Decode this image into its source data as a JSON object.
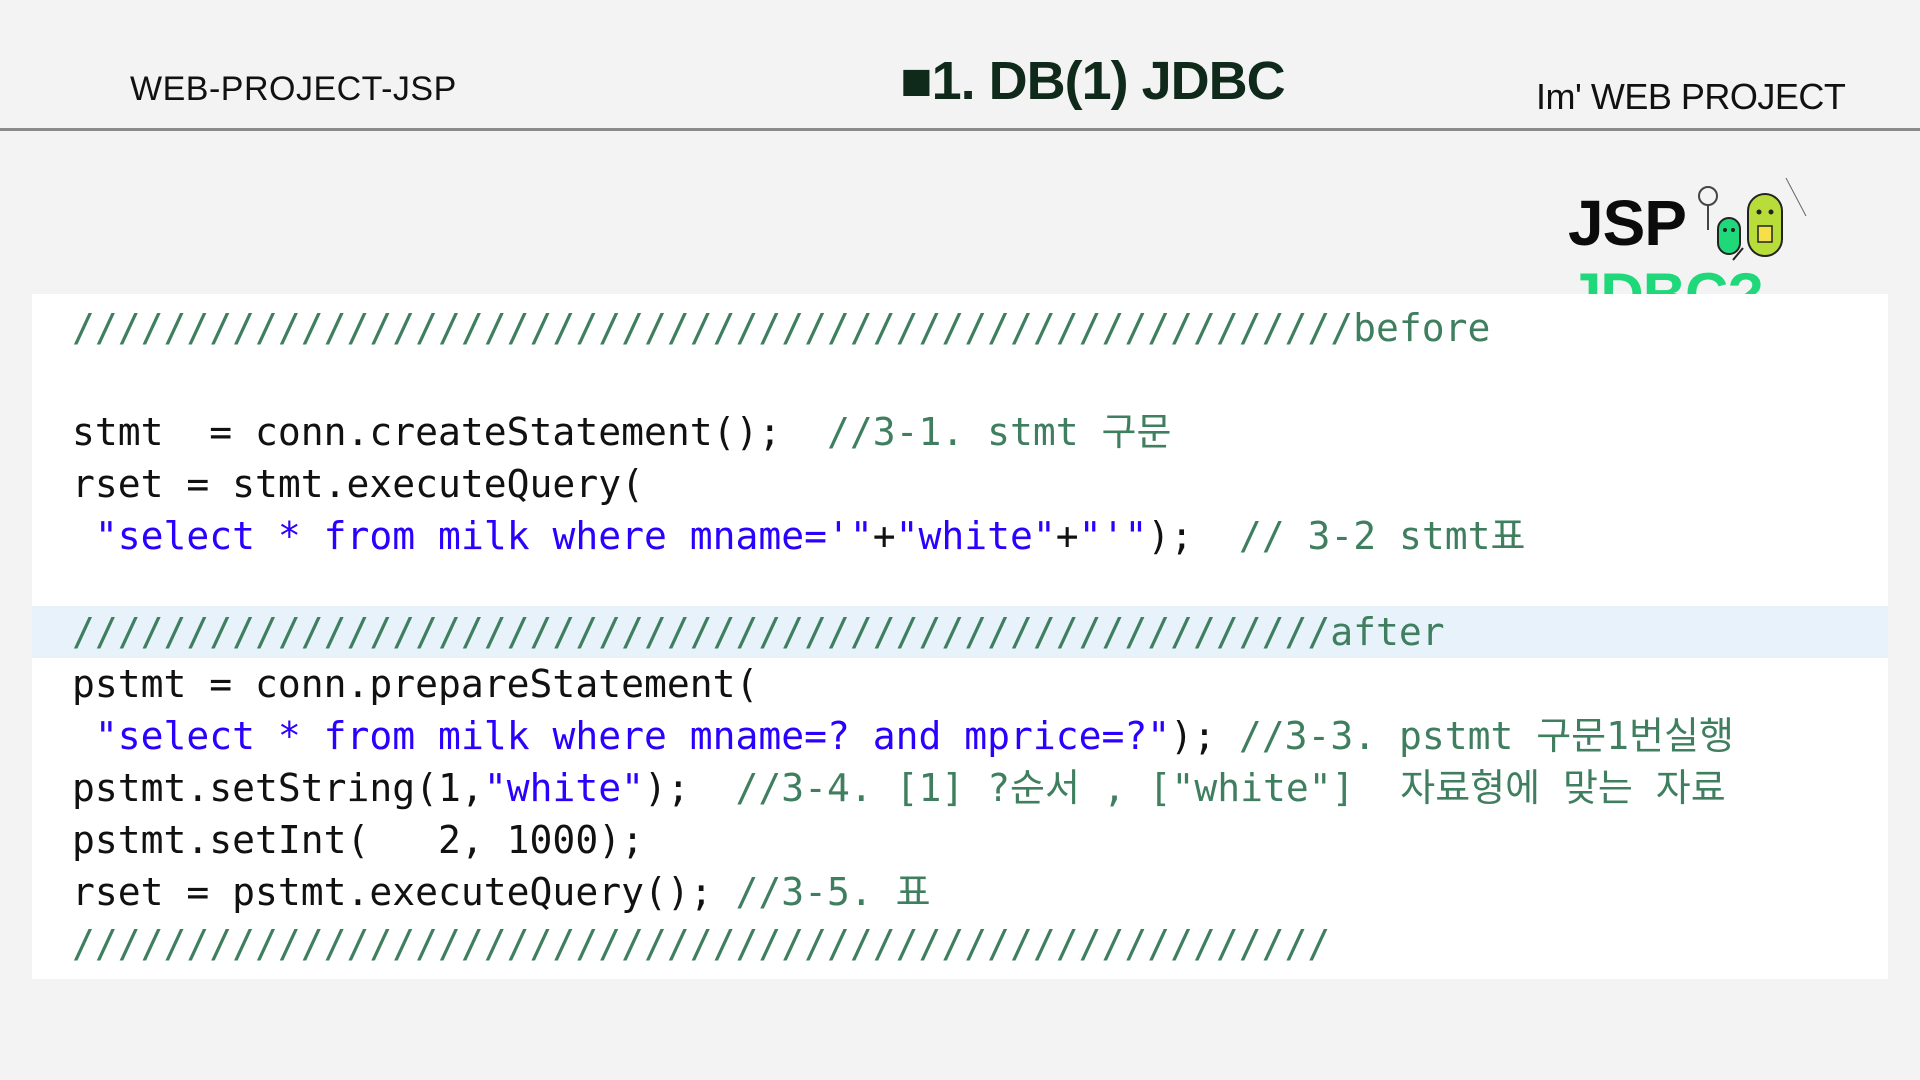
{
  "header": {
    "left": "WEB-PROJECT-JSP",
    "title": "■1. DB(1) JDBC",
    "right": "Im' WEB PROJECT"
  },
  "logo": {
    "jsp": "JSP",
    "question": "JDBC?",
    "accent_color": "#1fd87a",
    "mascot_icon": "mascot-icon"
  },
  "code": {
    "before_marker": "////////////////////////////////////////////////////////before",
    "l1_code": "stmt  = conn.createStatement();",
    "l1_comment": "//3-1. stmt 구문",
    "l2_code": "rset = stmt.executeQuery(",
    "l3_string1": "\"select * from milk where mname='\"",
    "l3_plus1": "+",
    "l3_string2": "\"white\"",
    "l3_plus2": "+",
    "l3_string3": "\"'\"",
    "l3_tail": ");",
    "l3_comment": "// 3-2 stmt표",
    "after_marker": "///////////////////////////////////////////////////////after",
    "l4_code": "pstmt = conn.prepareStatement(",
    "l5_string": "\"select * from milk where mname=? and mprice=?\"",
    "l5_tail": ");",
    "l5_comment": "//3-3. pstmt 구문1번실행",
    "l6_code": "pstmt.setString(1,",
    "l6_string": "\"white\"",
    "l6_tail": ");",
    "l6_comment": "//3-4. [1] ?순서 , [\"white\"]  자료형에 맞는 자료",
    "l7_code": "pstmt.setInt(   2, 1000);",
    "l8_code": "rset = pstmt.executeQuery();",
    "l8_comment": "//3-5. 표",
    "end_marker": "///////////////////////////////////////////////////////"
  },
  "colors": {
    "comment": "#3f7f5f",
    "string": "#2a00ff",
    "highlight": "#e8f2fa"
  }
}
